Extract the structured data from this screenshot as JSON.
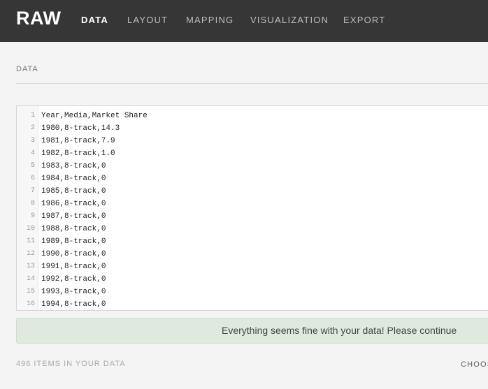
{
  "app": {
    "brand": "RAW",
    "nav": [
      "DATA",
      "LAYOUT",
      "MAPPING",
      "VISUALIZATION",
      "EXPORT"
    ],
    "active_nav": "DATA"
  },
  "section": {
    "title": "DATA"
  },
  "editor": {
    "lines": [
      "Year,Media,Market Share",
      "1980,8-track,14.3",
      "1981,8-track,7.9",
      "1982,8-track,1.0",
      "1983,8-track,0",
      "1984,8-track,0",
      "1985,8-track,0",
      "1986,8-track,0",
      "1987,8-track,0",
      "1988,8-track,0",
      "1989,8-track,0",
      "1990,8-track,0",
      "1991,8-track,0",
      "1992,8-track,0",
      "1993,8-track,0",
      "1994,8-track,0"
    ]
  },
  "status": {
    "message": "Everything seems fine with your data! Please continue"
  },
  "footer": {
    "items_count": "496 ITEMS IN YOUR DATA",
    "choose_label": "CHOOS"
  },
  "colors": {
    "topbar": "#363636",
    "success_bg": "#dfeadf",
    "page_bg": "#f4f4f4"
  }
}
